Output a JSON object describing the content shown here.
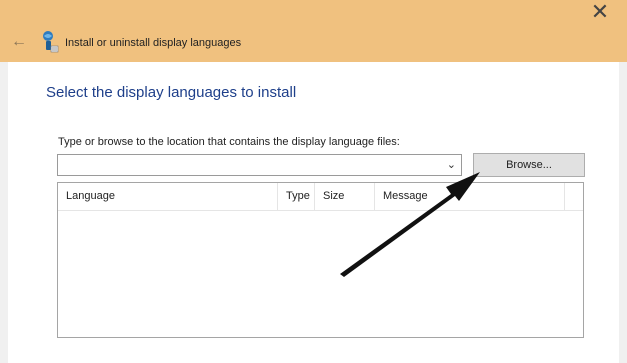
{
  "window": {
    "title": "Install or uninstall display languages",
    "close_glyph": "✕",
    "back_glyph": "←"
  },
  "main": {
    "heading": "Select the display languages to install",
    "instruction": "Type or browse to the location that contains the display language files:",
    "path_value": "",
    "dropdown_glyph": "⌄",
    "browse_label": "Browse..."
  },
  "list": {
    "columns": [
      "Language",
      "Type",
      "Size",
      "Message"
    ],
    "rows": []
  },
  "colors": {
    "titlebar": "#f0c17f",
    "heading": "#1e3f8a",
    "annotation_arrow": "#111111"
  },
  "icons": {
    "app": "globe-person-icon",
    "close": "close-icon",
    "back": "back-arrow-icon",
    "dropdown": "chevron-down-icon"
  }
}
